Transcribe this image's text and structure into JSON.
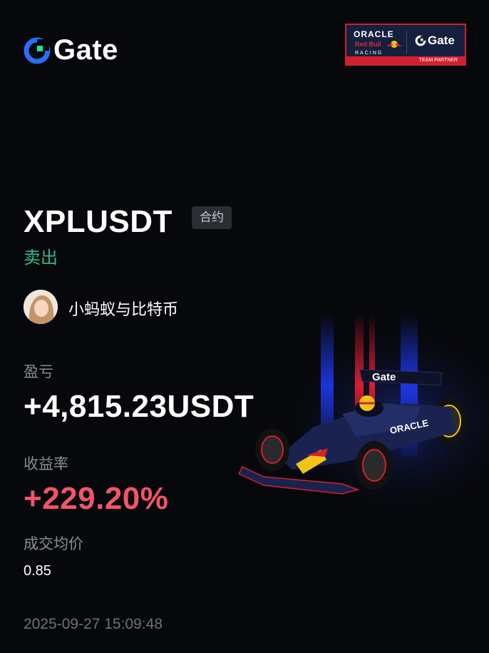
{
  "brand": {
    "name": "Gate"
  },
  "partner_badge": {
    "oracle": "ORACLE",
    "red_bull": "Red Bull",
    "racing": "RACING",
    "gate": "Gate",
    "label": "TEAM PARTNER"
  },
  "trade": {
    "pair": "XPLUSDT",
    "contract_tag": "合约",
    "side": "卖出",
    "side_color": "#2ebd85"
  },
  "user": {
    "name": "小蚂蚁与比特币"
  },
  "stats": {
    "pnl_label": "盈亏",
    "pnl_value": "+4,815.23USDT",
    "roi_label": "收益率",
    "roi_value": "+229.20%",
    "roi_color": "#f2546a",
    "avg_price_label": "成交均价",
    "avg_price_value": "0.85"
  },
  "timestamp": "2025-09-27 15:09:48",
  "car_livery": {
    "wing_text": "Gate",
    "sidepod_text": "ORACLE"
  }
}
